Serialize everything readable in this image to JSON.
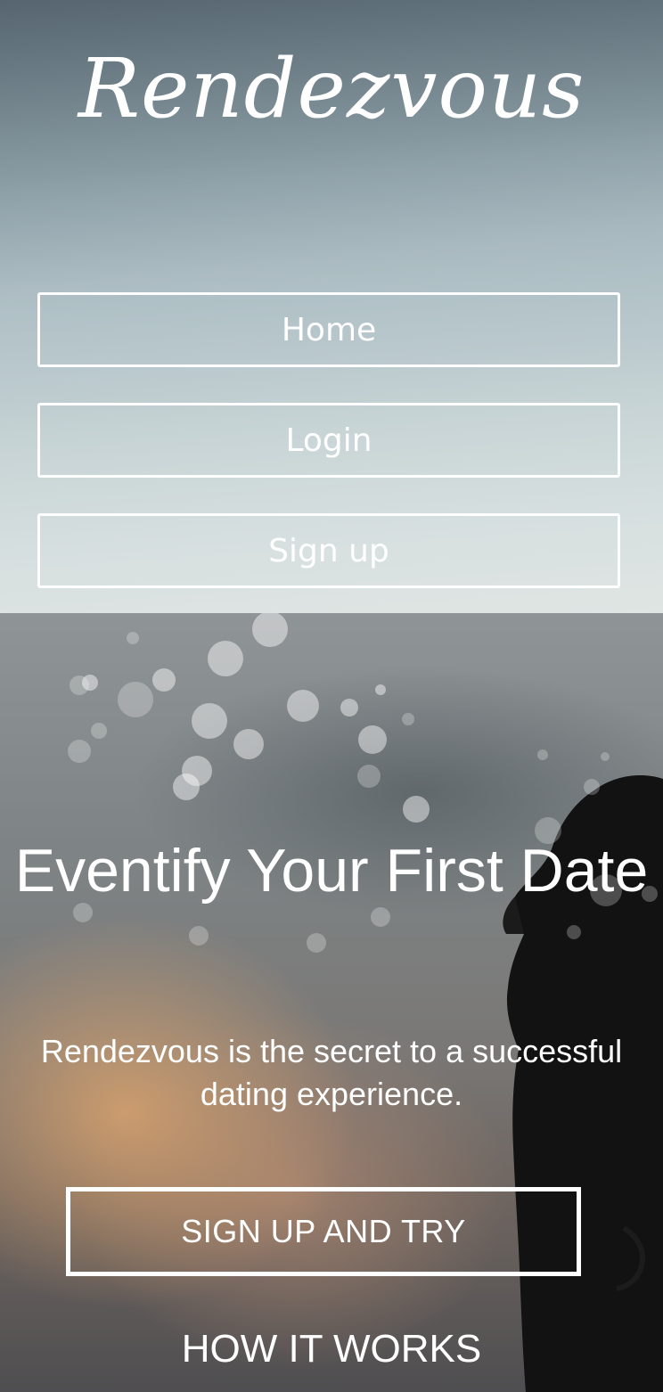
{
  "brand": {
    "name": "Rendezvous"
  },
  "nav": {
    "items": [
      {
        "label": "Home"
      },
      {
        "label": "Login"
      },
      {
        "label": "Sign up"
      }
    ]
  },
  "hero": {
    "title": "Eventify Your First Date",
    "subtitle": "Rendezvous is the secret to a successful dating experience.",
    "cta_label": "SIGN UP AND TRY",
    "how_label": "HOW IT WORKS"
  },
  "colors": {
    "text": "#ffffff",
    "border": "#ffffff"
  }
}
